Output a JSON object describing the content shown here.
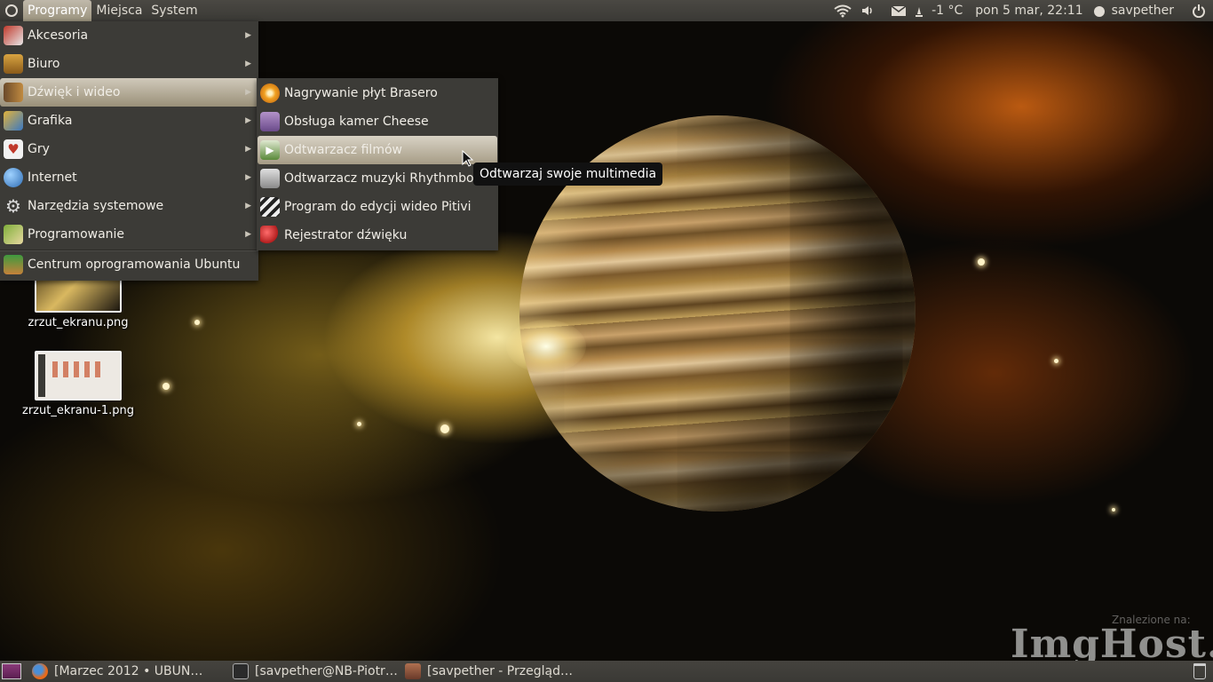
{
  "top_panel": {
    "menus": [
      "Programy",
      "Miejsca",
      "System"
    ],
    "temperature": "-1 °C",
    "clock": "pon  5 mar, 22:11",
    "user": "savpether"
  },
  "main_menu": {
    "items": [
      {
        "label": "Akcesoria",
        "icon": "accessories-icon"
      },
      {
        "label": "Biuro",
        "icon": "office-icon"
      },
      {
        "label": "Dźwięk i wideo",
        "icon": "multimedia-icon"
      },
      {
        "label": "Grafika",
        "icon": "graphics-icon"
      },
      {
        "label": "Gry",
        "icon": "games-icon"
      },
      {
        "label": "Internet",
        "icon": "internet-globe-icon"
      },
      {
        "label": "Narzędzia systemowe",
        "icon": "system-tools-gear-icon"
      },
      {
        "label": "Programowanie",
        "icon": "programming-icon"
      },
      {
        "label": "Centrum oprogramowania Ubuntu",
        "icon": "software-center-icon"
      }
    ],
    "highlighted_index": 2
  },
  "submenu": {
    "items": [
      {
        "label": "Nagrywanie płyt Brasero",
        "icon": "brasero-disc-icon"
      },
      {
        "label": "Obsługa kamer Cheese",
        "icon": "cheese-webcam-icon"
      },
      {
        "label": "Odtwarzacz filmów",
        "icon": "movie-player-icon"
      },
      {
        "label": "Odtwarzacz muzyki Rhythmbox",
        "icon": "rhythmbox-speaker-icon"
      },
      {
        "label": "Program do edycji wideo Pitivi",
        "icon": "pitivi-clapper-icon"
      },
      {
        "label": "Rejestrator dźwięku",
        "icon": "sound-recorder-icon"
      }
    ],
    "highlighted_index": 2
  },
  "tooltip": "Odtwarzaj swoje multimedia",
  "desktop_icons": [
    {
      "label": "zrzut_ekranu.png"
    },
    {
      "label": "zrzut_ekranu-1.png"
    }
  ],
  "taskbar": [
    {
      "label": "[Marzec 2012 • UBUN…",
      "icon": "firefox-icon"
    },
    {
      "label": "[savpether@NB-Piotr…",
      "icon": "terminal-icon"
    },
    {
      "label": "[savpether - Przegląd…",
      "icon": "file-manager-icon"
    }
  ],
  "watermark": {
    "small": "Znalezione na:",
    "large": "ImgHost.pl"
  },
  "colors": {
    "panel": "#3c3b37",
    "highlight": "#b0a690",
    "tooltip_bg": "#111111"
  }
}
